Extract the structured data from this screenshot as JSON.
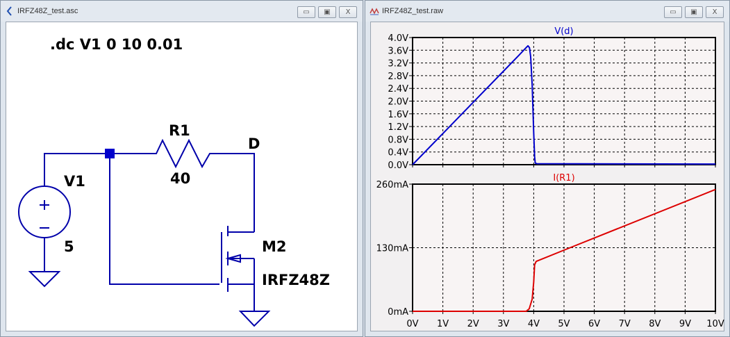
{
  "schematic_window": {
    "title": "IRFZ48Z_test.asc",
    "directive": ".dc V1 0 10 0.01",
    "components": {
      "r1_name": "R1",
      "r1_value": "40",
      "v1_name": "V1",
      "v1_value": "5",
      "m2_name": "M2",
      "m2_model": "IRFZ48Z",
      "net_label": "D"
    },
    "wire_color": "#0000aa"
  },
  "plot_window": {
    "title": "IRFZ48Z_test.raw",
    "buttons": {
      "minimize": "▭",
      "maximize": "▣",
      "close": "X"
    }
  },
  "chart_data": [
    {
      "type": "line",
      "title": "V(d)",
      "color": "#0000cc",
      "xlim": [
        0,
        10
      ],
      "ylim": [
        0,
        4.0
      ],
      "x_ticks": [
        "0V",
        "1V",
        "2V",
        "3V",
        "4V",
        "5V",
        "6V",
        "7V",
        "8V",
        "9V",
        "10V"
      ],
      "y_ticks": [
        "0.0V",
        "0.4V",
        "0.8V",
        "1.2V",
        "1.6V",
        "2.0V",
        "2.4V",
        "2.8V",
        "3.2V",
        "3.6V",
        "4.0V"
      ],
      "y_tick_values": [
        0,
        0.4,
        0.8,
        1.2,
        1.6,
        2.0,
        2.4,
        2.8,
        3.2,
        3.6,
        4.0
      ],
      "grid": true,
      "x": [
        0,
        1,
        2,
        3,
        3.5,
        3.75,
        3.81,
        3.86,
        3.9,
        3.95,
        4.0,
        4.03,
        4.05,
        4.1,
        10
      ],
      "y": [
        0,
        0.98,
        1.96,
        2.94,
        3.43,
        3.68,
        3.74,
        3.68,
        3.4,
        2.5,
        1.0,
        0.25,
        0.05,
        0.03,
        0.02
      ]
    },
    {
      "type": "line",
      "title": "I(R1)",
      "color": "#dd0000",
      "xlim": [
        0,
        10
      ],
      "ylim": [
        0,
        260
      ],
      "x_ticks": [
        "0V",
        "1V",
        "2V",
        "3V",
        "4V",
        "5V",
        "6V",
        "7V",
        "8V",
        "9V",
        "10V"
      ],
      "y_ticks": [
        "0mA",
        "130mA",
        "260mA"
      ],
      "y_tick_values": [
        0,
        130,
        260
      ],
      "grid": true,
      "x": [
        0,
        3.75,
        3.85,
        3.95,
        4.0,
        4.03,
        4.08,
        5,
        10
      ],
      "y": [
        0,
        0,
        5,
        25,
        60,
        95,
        102,
        125,
        249
      ]
    }
  ]
}
